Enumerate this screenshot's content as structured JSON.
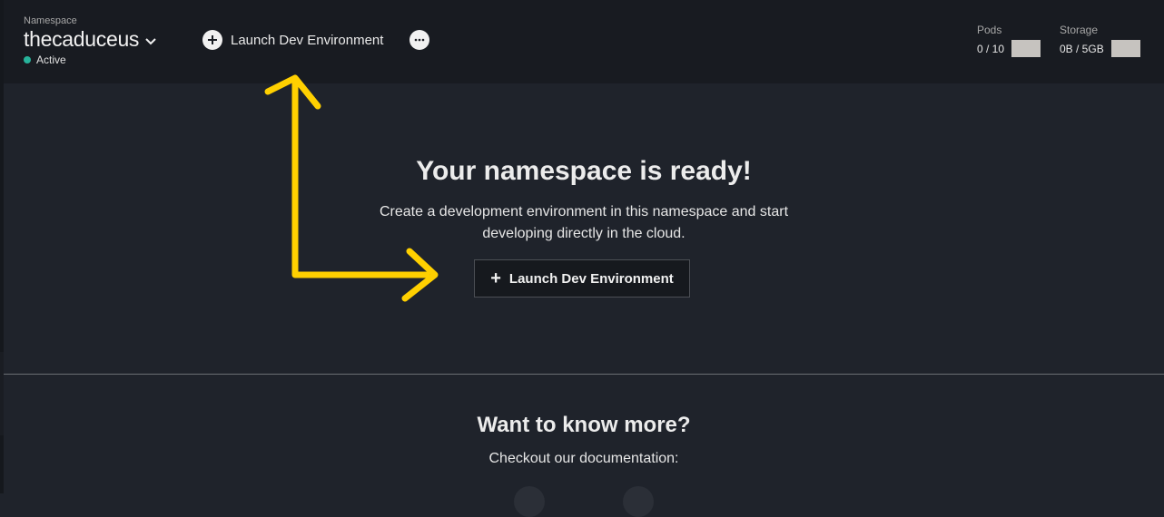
{
  "header": {
    "namespace_label": "Namespace",
    "namespace_name": "thecaduceus",
    "status": "Active",
    "launch_label": "Launch Dev Environment",
    "pods": {
      "label": "Pods",
      "value": "0 / 10"
    },
    "storage": {
      "label": "Storage",
      "value": "0B / 5GB"
    }
  },
  "hero": {
    "title": "Your namespace is ready!",
    "description": "Create a development environment in this namespace and start developing directly in the cloud.",
    "launch_label": "Launch Dev Environment"
  },
  "more": {
    "title": "Want to know more?",
    "subtitle": "Checkout our documentation:"
  },
  "colors": {
    "header_bg": "#181b21",
    "page_bg": "#1f232b",
    "status_green": "#27b39b",
    "annotation_yellow": "#ffd000"
  }
}
